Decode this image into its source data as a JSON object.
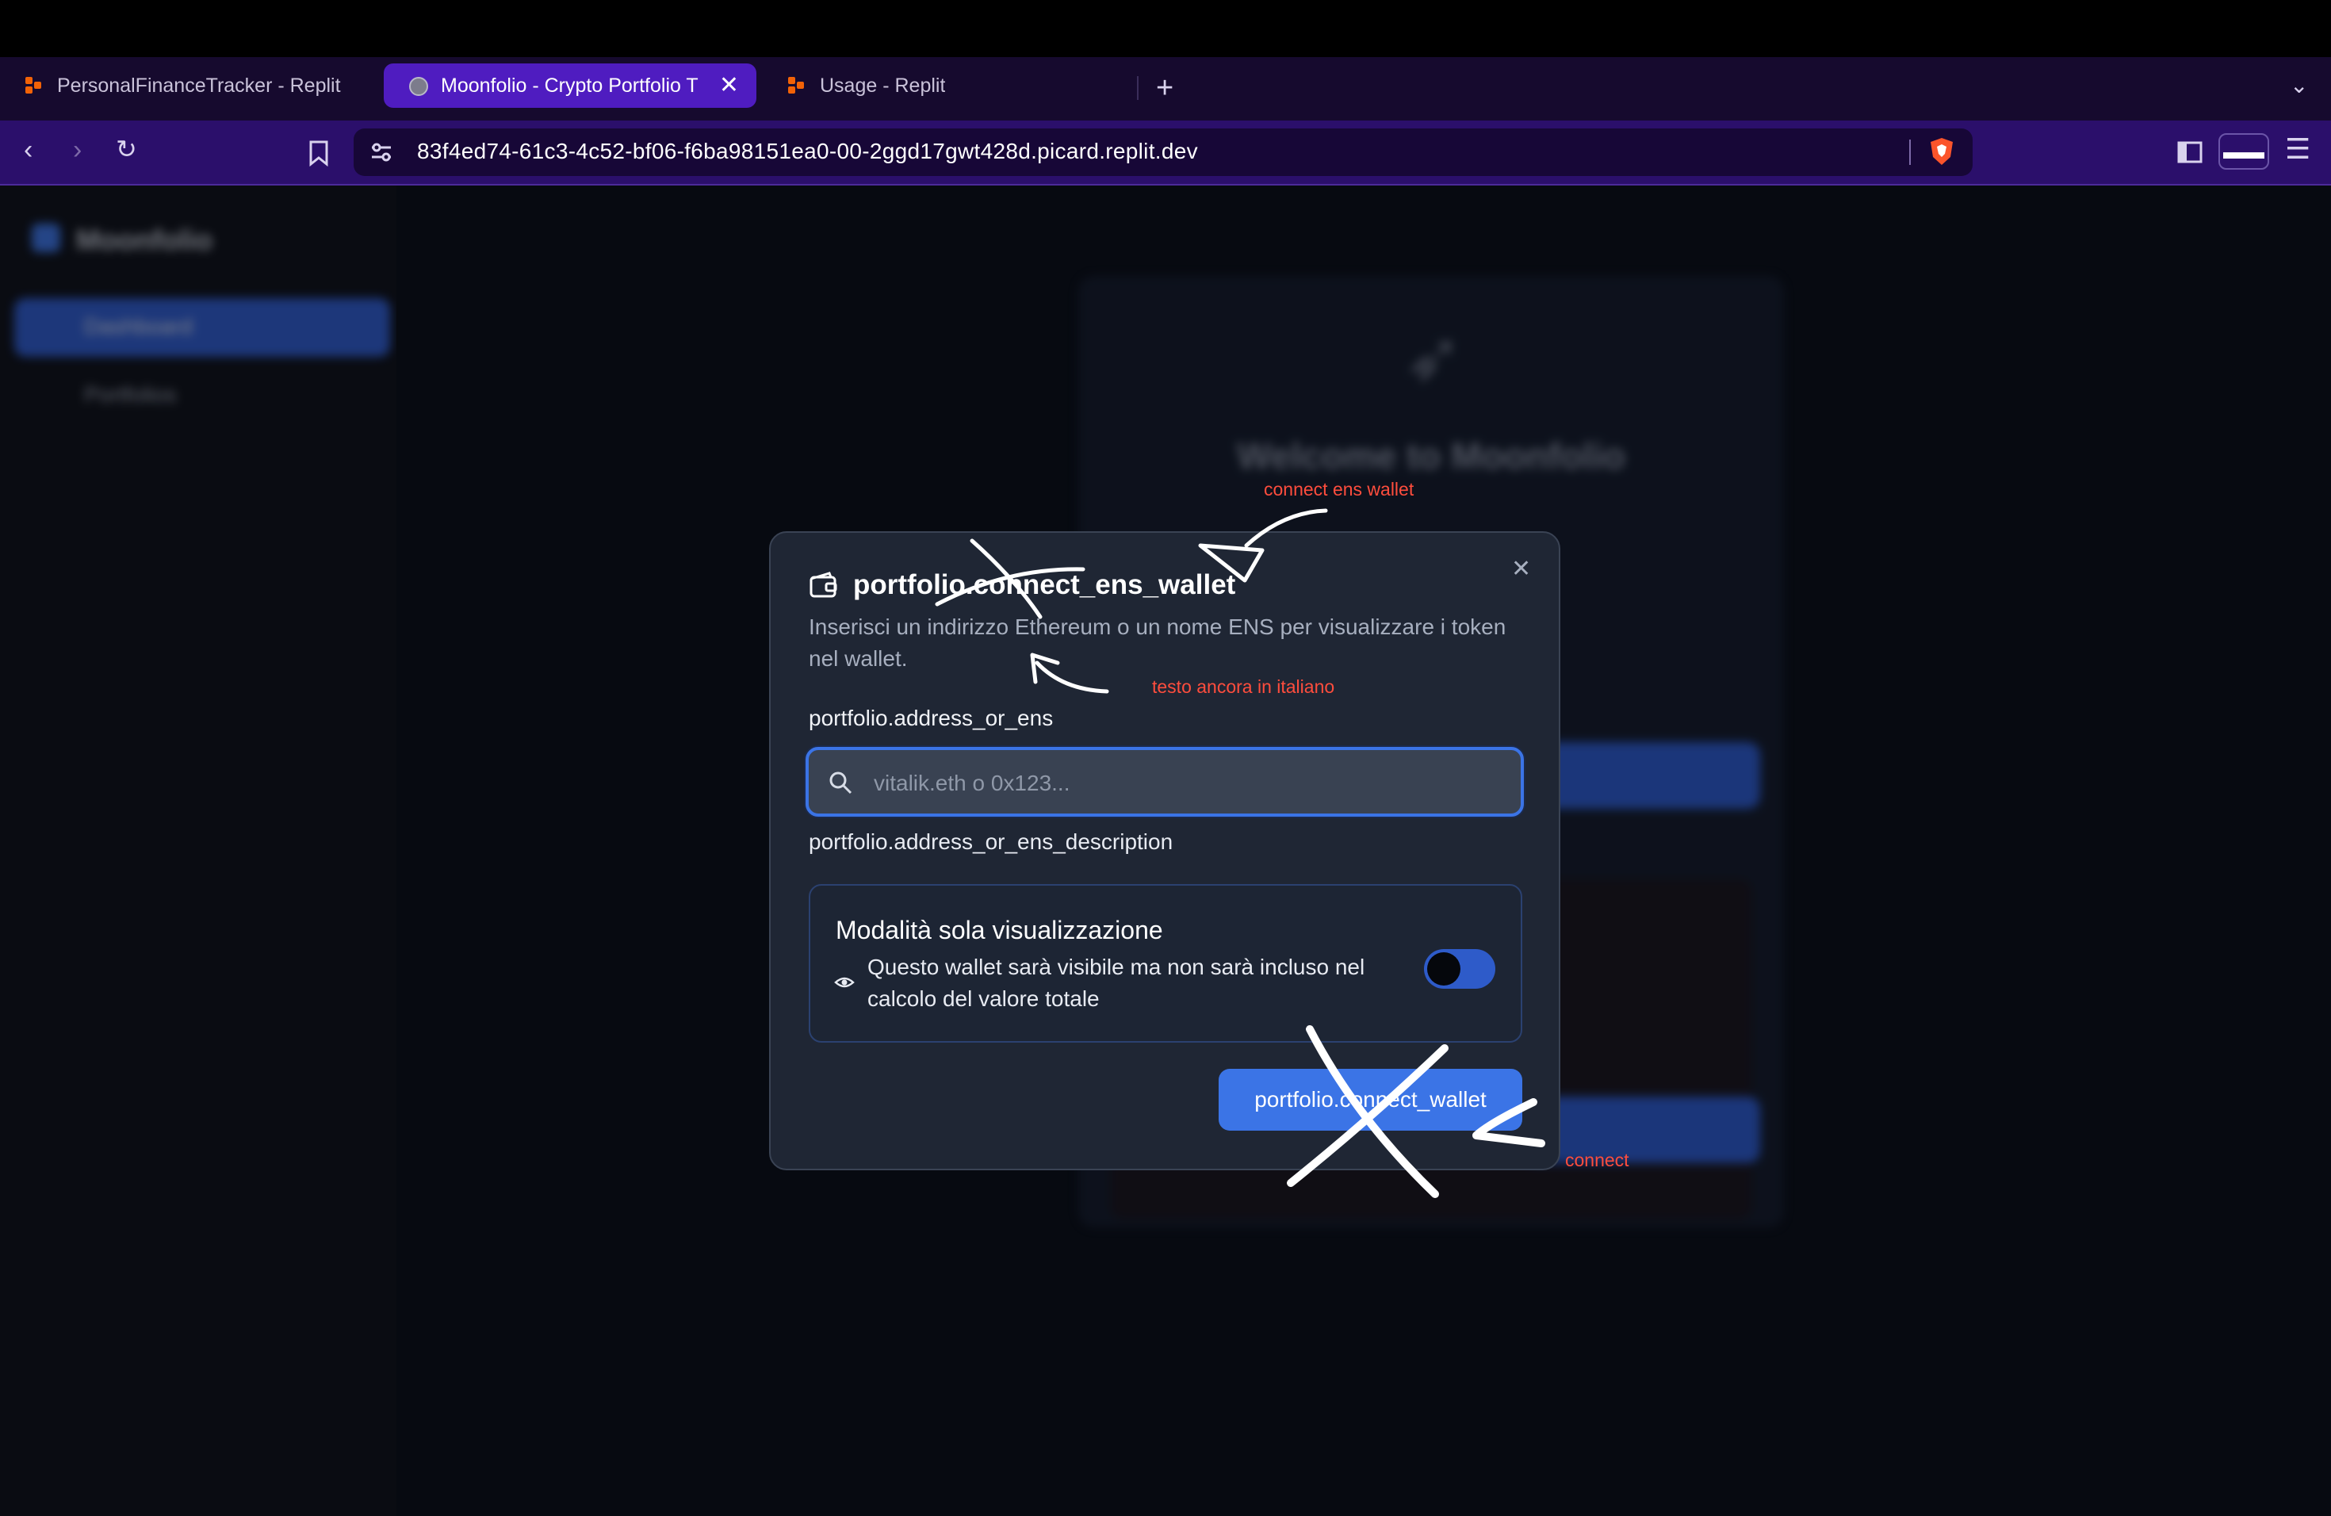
{
  "browser": {
    "tabs": [
      {
        "title": "PersonalFinanceTracker - Replit",
        "active": false,
        "icon": "replit-icon"
      },
      {
        "title": "Moonfolio - Crypto Portfolio T",
        "active": true,
        "icon": "globe-icon"
      },
      {
        "title": "Usage - Replit",
        "active": false,
        "icon": "replit-icon"
      }
    ],
    "url": "83f4ed74-61c3-4c52-bf06-f6ba98151ea0-00-2ggd17gwt428d.picard.replit.dev"
  },
  "background_app": {
    "brand": "Moonfolio",
    "sidebar_items": [
      "Dashboard",
      "Portfolios"
    ],
    "welcome_title": "Welcome to Moonfolio"
  },
  "modal": {
    "title": "portfolio.connect_ens_wallet",
    "description": "Inserisci un indirizzo Ethereum o un nome ENS per visualizzare i token nel wallet.",
    "field_label": "portfolio.address_or_ens",
    "input_placeholder": "vitalik.eth o 0x123...",
    "input_value": "",
    "field_description": "portfolio.address_or_ens_description",
    "view_only": {
      "title": "Modalità sola visualizzazione",
      "description": "Questo wallet sarà visibile ma non sarà incluso nel calcolo del valore totale",
      "enabled": false
    },
    "submit_label": "portfolio.connect_wallet"
  },
  "annotations": {
    "title_note": "connect ens wallet",
    "description_note": "testo ancora in italiano",
    "button_note": "connect"
  },
  "colors": {
    "accent": "#3b74e6",
    "annotation": "#ff4d3d",
    "modal_bg": "#1f2634"
  }
}
